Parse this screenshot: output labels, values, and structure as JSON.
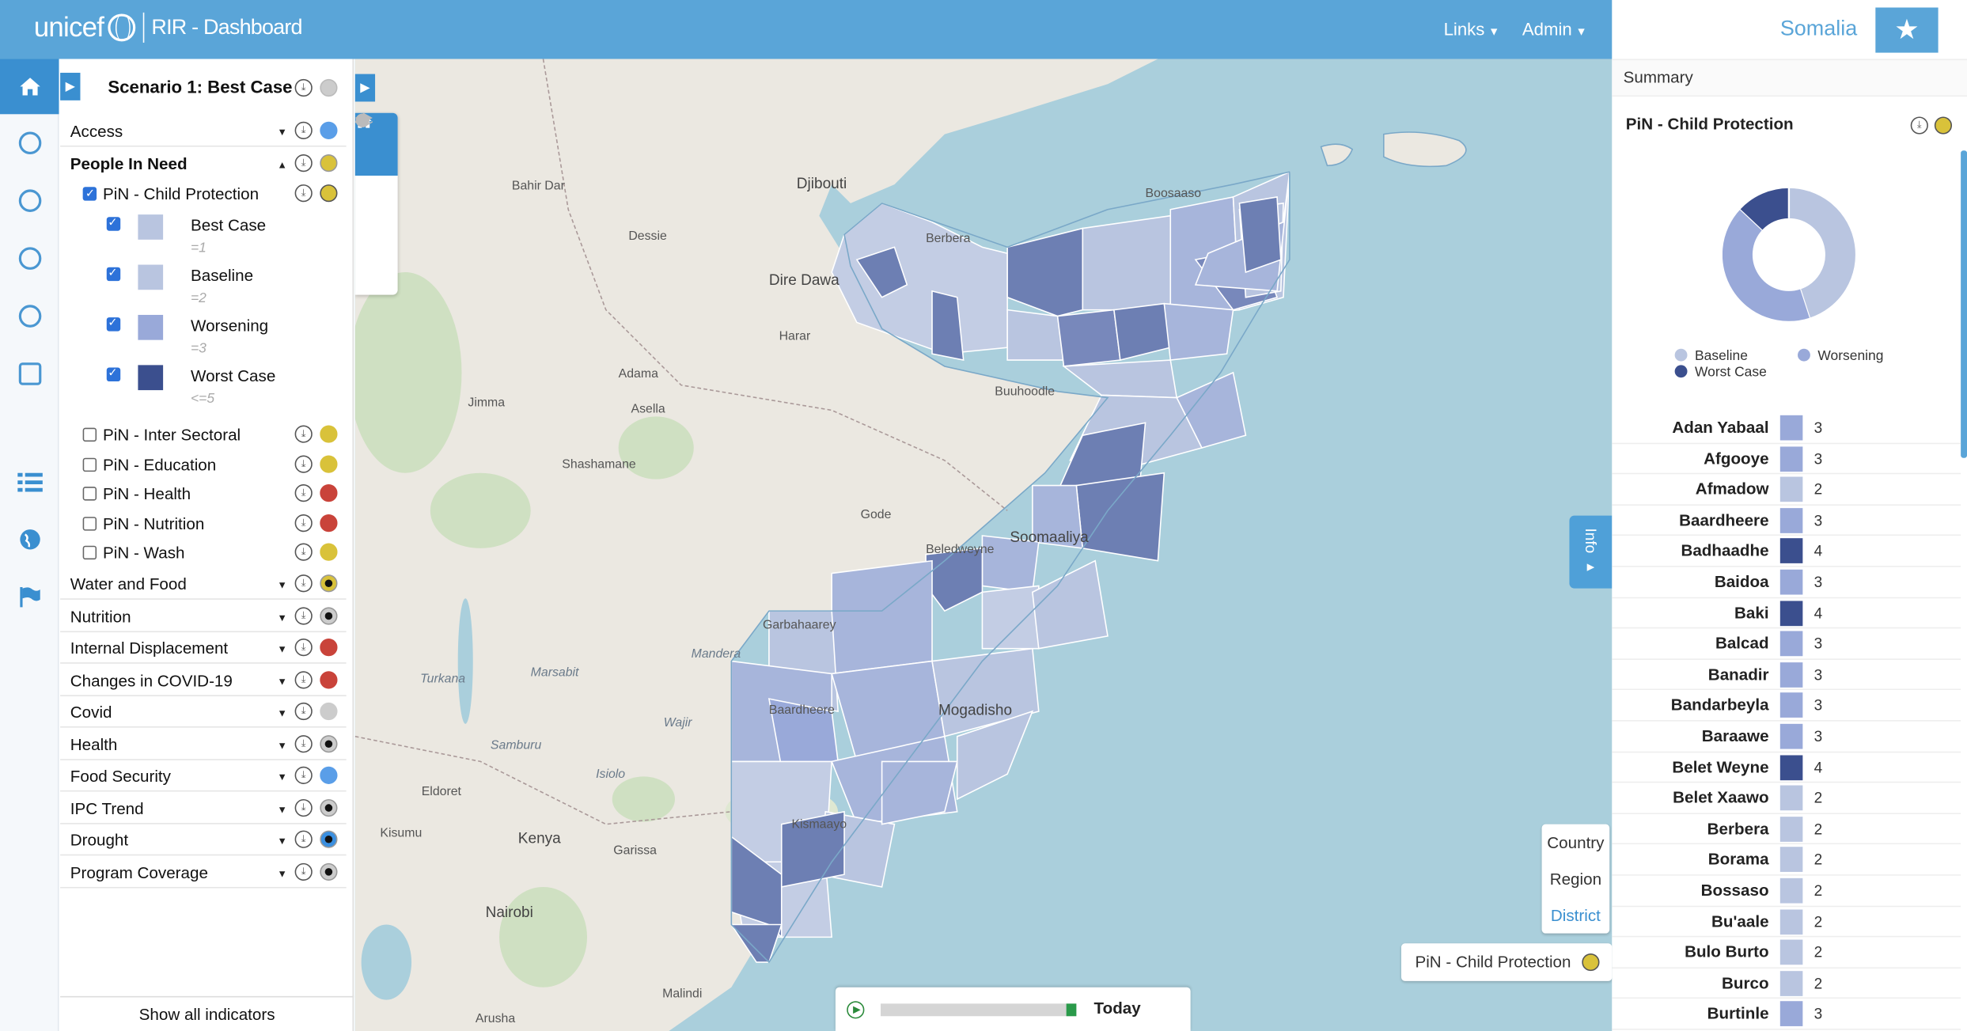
{
  "header": {
    "logo_text": "unicef",
    "app_title": "RIR - Dashboard",
    "nav": [
      {
        "label": "Links"
      },
      {
        "label": "Admin"
      }
    ]
  },
  "scenario": {
    "title": "Scenario 1: Best Case"
  },
  "indicators": [
    {
      "label": "Access",
      "expanded": false,
      "color": "#5a9ee8"
    },
    {
      "label": "People In Need",
      "expanded": true,
      "color": "#d9c23a"
    }
  ],
  "pin_layers": [
    {
      "label": "PiN - Child Protection",
      "checked": true,
      "color": "#d9c23a"
    },
    {
      "label": "PiN - Inter Sectoral",
      "checked": false,
      "color": "#d9c23a"
    },
    {
      "label": "PiN - Education",
      "checked": false,
      "color": "#d9c23a"
    },
    {
      "label": "PiN - Health",
      "checked": false,
      "color": "#c9433a"
    },
    {
      "label": "PiN - Nutrition",
      "checked": false,
      "color": "#c9433a"
    },
    {
      "label": "PiN - Wash",
      "checked": false,
      "color": "#d9c23a"
    }
  ],
  "legend_items": [
    {
      "name": "Best Case",
      "value": "=1",
      "color": "#b9c5e0"
    },
    {
      "name": "Baseline",
      "value": "=2",
      "color": "#b9c5e0"
    },
    {
      "name": "Worsening",
      "value": "=3",
      "color": "#99a9d9"
    },
    {
      "name": "Worst Case",
      "value": "<=5",
      "color": "#3b4f8e"
    }
  ],
  "categories": [
    {
      "label": "Water and Food",
      "dot": "ring",
      "color": "#d9c23a"
    },
    {
      "label": "Nutrition",
      "dot": "ring",
      "color": "#cccccc"
    },
    {
      "label": "Internal Displacement",
      "dot": "solid",
      "color": "#c9433a"
    },
    {
      "label": "Changes in COVID-19",
      "dot": "solid",
      "color": "#c9433a"
    },
    {
      "label": "Covid",
      "dot": "solid",
      "color": "#cccccc"
    },
    {
      "label": "Health",
      "dot": "ring",
      "color": "#cccccc"
    },
    {
      "label": "Food Security",
      "dot": "solid",
      "color": "#5a9ee8"
    },
    {
      "label": "IPC Trend",
      "dot": "ring",
      "color": "#cccccc"
    },
    {
      "label": "Drought",
      "dot": "ring",
      "color": "#3a8fe0"
    },
    {
      "label": "Program Coverage",
      "dot": "ring",
      "color": "#cccccc"
    }
  ],
  "show_all": "Show all indicators",
  "map": {
    "labels": [
      {
        "text": "Djibouti",
        "cls": "big"
      },
      {
        "text": "Boosaaso",
        "cls": ""
      },
      {
        "text": "Berbera",
        "cls": ""
      },
      {
        "text": "Buuhoodle",
        "cls": ""
      },
      {
        "text": "Soomaaliya",
        "cls": "big"
      },
      {
        "text": "Beledweyne",
        "cls": ""
      },
      {
        "text": "Garbahaarey",
        "cls": ""
      },
      {
        "text": "Baardheere",
        "cls": ""
      },
      {
        "text": "Kismaayo",
        "cls": ""
      },
      {
        "text": "Mogadisho",
        "cls": "big"
      },
      {
        "text": "Nairobi",
        "cls": "big"
      },
      {
        "text": "Kenya",
        "cls": "big"
      },
      {
        "text": "Dire Dawa",
        "cls": "big"
      },
      {
        "text": "Adama",
        "cls": ""
      },
      {
        "text": "Harar",
        "cls": ""
      },
      {
        "text": "Mandera",
        "cls": "it"
      },
      {
        "text": "Marsabit",
        "cls": "it"
      },
      {
        "text": "Wajir",
        "cls": "it"
      },
      {
        "text": "Garissa",
        "cls": ""
      },
      {
        "text": "Kisumu",
        "cls": ""
      },
      {
        "text": "Eldoret",
        "cls": ""
      },
      {
        "text": "Arusha",
        "cls": ""
      },
      {
        "text": "Malindi",
        "cls": ""
      },
      {
        "text": "Gode",
        "cls": ""
      },
      {
        "text": "Bahir Dar",
        "cls": ""
      },
      {
        "text": "Dessie",
        "cls": ""
      },
      {
        "text": "Jimma",
        "cls": ""
      },
      {
        "text": "Asella",
        "cls": ""
      },
      {
        "text": "Shashamane",
        "cls": ""
      },
      {
        "text": "Turkana",
        "cls": "it"
      },
      {
        "text": "Isiolo",
        "cls": "it"
      },
      {
        "text": "Samburu",
        "cls": "it"
      }
    ],
    "info_tab": "Info",
    "levels": [
      "Country",
      "Region",
      "District"
    ],
    "active_level": "District",
    "layer_chip": "PiN - Child Protection",
    "timeline_label": "Today"
  },
  "right_panel": {
    "country": "Somalia",
    "summary": "Summary",
    "panel_title": "PiN - Child Protection",
    "donut": [
      {
        "name": "Baseline",
        "value": 45,
        "color": "#b9c5e0"
      },
      {
        "name": "Worsening",
        "value": 42,
        "color": "#99a9d9"
      },
      {
        "name": "Worst Case",
        "value": 13,
        "color": "#3b4f8e"
      }
    ]
  },
  "districts": [
    {
      "name": "Adan Yabaal",
      "value": "3"
    },
    {
      "name": "Afgooye",
      "value": "3"
    },
    {
      "name": "Afmadow",
      "value": "2"
    },
    {
      "name": "Baardheere",
      "value": "3"
    },
    {
      "name": "Badhaadhe",
      "value": "4"
    },
    {
      "name": "Baidoa",
      "value": "3"
    },
    {
      "name": "Baki",
      "value": "4"
    },
    {
      "name": "Balcad",
      "value": "3"
    },
    {
      "name": "Banadir",
      "value": "3"
    },
    {
      "name": "Bandarbeyla",
      "value": "3"
    },
    {
      "name": "Baraawe",
      "value": "3"
    },
    {
      "name": "Belet Weyne",
      "value": "4"
    },
    {
      "name": "Belet Xaawo",
      "value": "2"
    },
    {
      "name": "Berbera",
      "value": "2"
    },
    {
      "name": "Borama",
      "value": "2"
    },
    {
      "name": "Bossaso",
      "value": "2"
    },
    {
      "name": "Bu'aale",
      "value": "2"
    },
    {
      "name": "Bulo Burto",
      "value": "2"
    },
    {
      "name": "Burco",
      "value": "2"
    },
    {
      "name": "Burtinle",
      "value": "3"
    }
  ]
}
